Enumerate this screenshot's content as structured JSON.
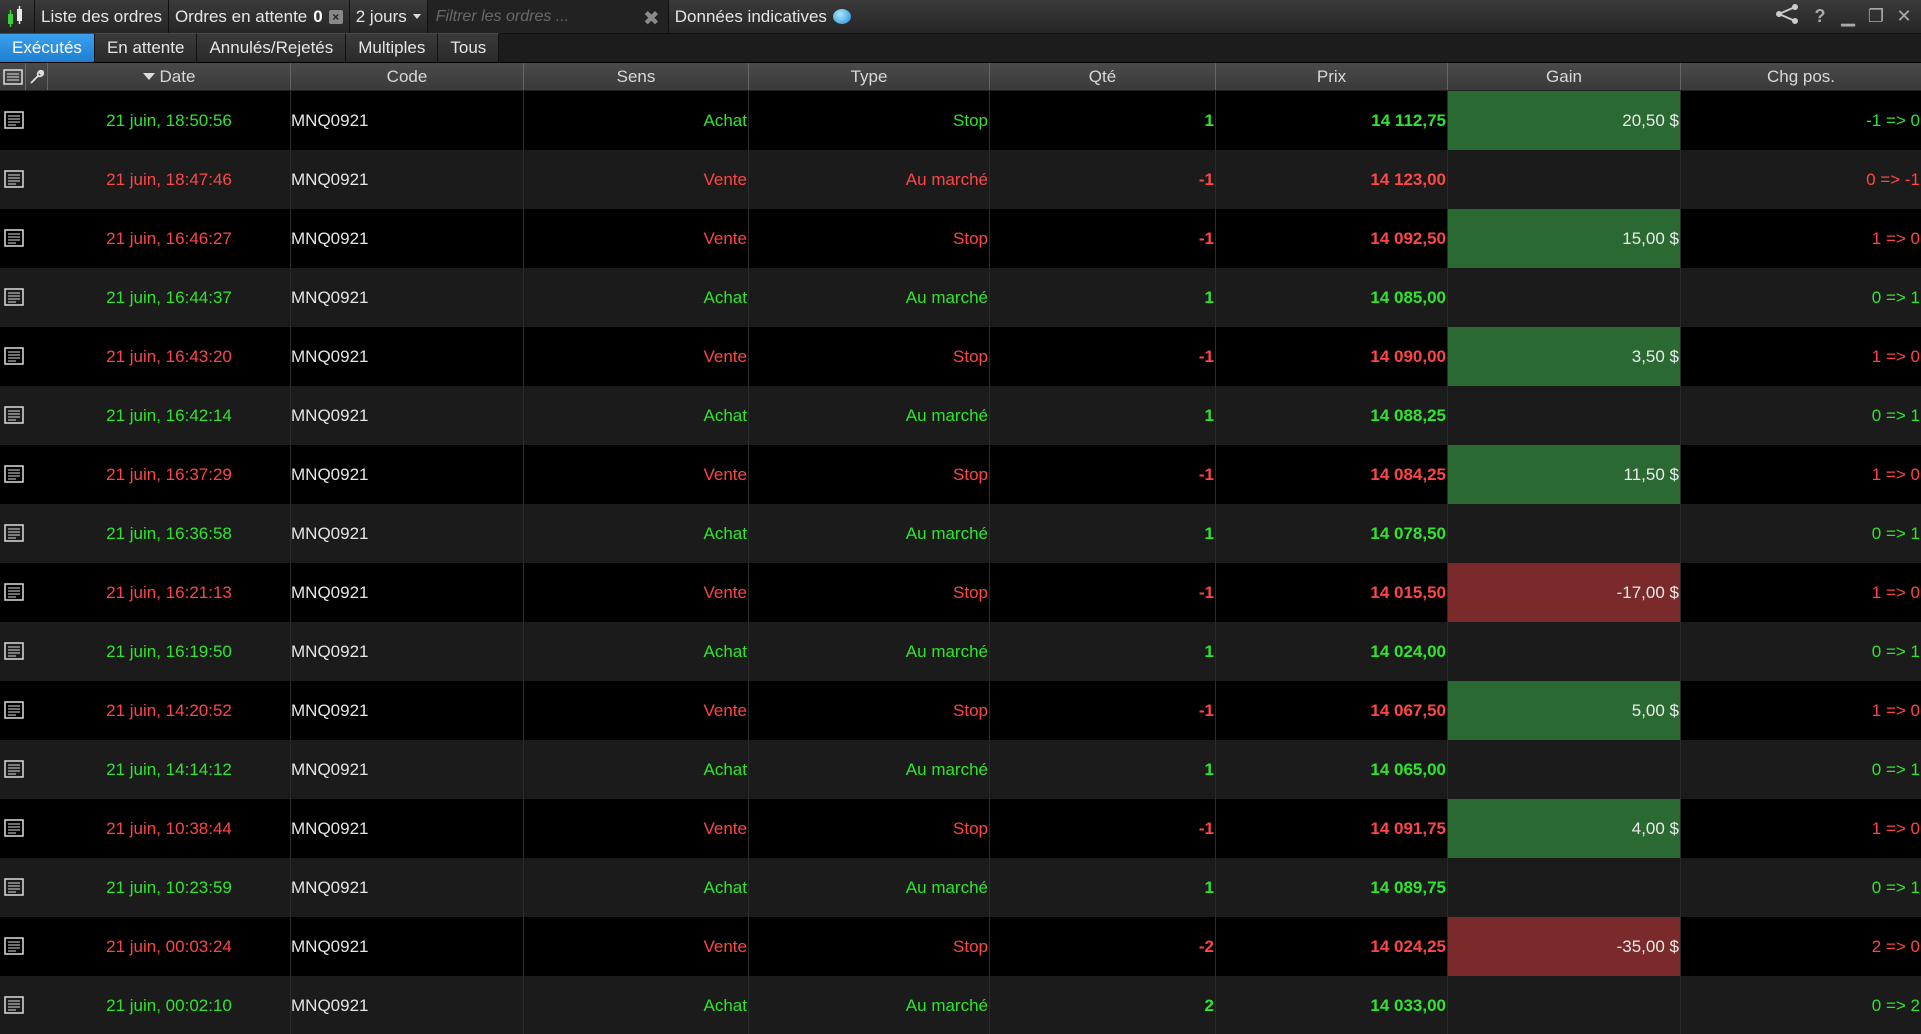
{
  "toolbar": {
    "orders_list_label": "Liste des ordres",
    "pending_label": "Ordres en attente",
    "pending_count": "0",
    "period_label": "2 jours",
    "filter_placeholder": "Filtrer les ordres ...",
    "filter_clear": "✖",
    "indicative_label": "Données indicatives",
    "help": "?"
  },
  "tabs": [
    {
      "label": "Exécutés",
      "active": true
    },
    {
      "label": "En attente",
      "active": false
    },
    {
      "label": "Annulés/Rejetés",
      "active": false
    },
    {
      "label": "Multiples",
      "active": false
    },
    {
      "label": "Tous",
      "active": false
    }
  ],
  "columns": {
    "date": "Date",
    "code": "Code",
    "sens": "Sens",
    "type": "Type",
    "qty": "Qté",
    "price": "Prix",
    "gain": "Gain",
    "pos": "Chg pos."
  },
  "colors": {
    "buy": "#2ee52e",
    "sell": "#ff4545",
    "gain_positive_bg": "#2a6a32",
    "gain_negative_bg": "#7a2a2a",
    "active_tab": "#2d8fe0"
  },
  "rows": [
    {
      "date": "21 juin, 18:50:56",
      "code": "MNQ0921",
      "sens": "Achat",
      "type": "Stop",
      "qty": "1",
      "price": "14 112,75",
      "gain": "20,50 $",
      "gain_sign": "pos",
      "pos": "-1 => 0"
    },
    {
      "date": "21 juin, 18:47:46",
      "code": "MNQ0921",
      "sens": "Vente",
      "type": "Au marché",
      "qty": "-1",
      "price": "14 123,00",
      "gain": "",
      "gain_sign": "",
      "pos": "0 => -1"
    },
    {
      "date": "21 juin, 16:46:27",
      "code": "MNQ0921",
      "sens": "Vente",
      "type": "Stop",
      "qty": "-1",
      "price": "14 092,50",
      "gain": "15,00 $",
      "gain_sign": "pos",
      "pos": "1 => 0"
    },
    {
      "date": "21 juin, 16:44:37",
      "code": "MNQ0921",
      "sens": "Achat",
      "type": "Au marché",
      "qty": "1",
      "price": "14 085,00",
      "gain": "",
      "gain_sign": "",
      "pos": "0 => 1"
    },
    {
      "date": "21 juin, 16:43:20",
      "code": "MNQ0921",
      "sens": "Vente",
      "type": "Stop",
      "qty": "-1",
      "price": "14 090,00",
      "gain": "3,50 $",
      "gain_sign": "pos",
      "pos": "1 => 0"
    },
    {
      "date": "21 juin, 16:42:14",
      "code": "MNQ0921",
      "sens": "Achat",
      "type": "Au marché",
      "qty": "1",
      "price": "14 088,25",
      "gain": "",
      "gain_sign": "",
      "pos": "0 => 1"
    },
    {
      "date": "21 juin, 16:37:29",
      "code": "MNQ0921",
      "sens": "Vente",
      "type": "Stop",
      "qty": "-1",
      "price": "14 084,25",
      "gain": "11,50 $",
      "gain_sign": "pos",
      "pos": "1 => 0"
    },
    {
      "date": "21 juin, 16:36:58",
      "code": "MNQ0921",
      "sens": "Achat",
      "type": "Au marché",
      "qty": "1",
      "price": "14 078,50",
      "gain": "",
      "gain_sign": "",
      "pos": "0 => 1"
    },
    {
      "date": "21 juin, 16:21:13",
      "code": "MNQ0921",
      "sens": "Vente",
      "type": "Stop",
      "qty": "-1",
      "price": "14 015,50",
      "gain": "-17,00 $",
      "gain_sign": "neg",
      "pos": "1 => 0"
    },
    {
      "date": "21 juin, 16:19:50",
      "code": "MNQ0921",
      "sens": "Achat",
      "type": "Au marché",
      "qty": "1",
      "price": "14 024,00",
      "gain": "",
      "gain_sign": "",
      "pos": "0 => 1"
    },
    {
      "date": "21 juin, 14:20:52",
      "code": "MNQ0921",
      "sens": "Vente",
      "type": "Stop",
      "qty": "-1",
      "price": "14 067,50",
      "gain": "5,00 $",
      "gain_sign": "pos",
      "pos": "1 => 0"
    },
    {
      "date": "21 juin, 14:14:12",
      "code": "MNQ0921",
      "sens": "Achat",
      "type": "Au marché",
      "qty": "1",
      "price": "14 065,00",
      "gain": "",
      "gain_sign": "",
      "pos": "0 => 1"
    },
    {
      "date": "21 juin, 10:38:44",
      "code": "MNQ0921",
      "sens": "Vente",
      "type": "Stop",
      "qty": "-1",
      "price": "14 091,75",
      "gain": "4,00 $",
      "gain_sign": "pos",
      "pos": "1 => 0"
    },
    {
      "date": "21 juin, 10:23:59",
      "code": "MNQ0921",
      "sens": "Achat",
      "type": "Au marché",
      "qty": "1",
      "price": "14 089,75",
      "gain": "",
      "gain_sign": "",
      "pos": "0 => 1"
    },
    {
      "date": "21 juin, 00:03:24",
      "code": "MNQ0921",
      "sens": "Vente",
      "type": "Stop",
      "qty": "-2",
      "price": "14 024,25",
      "gain": "-35,00 $",
      "gain_sign": "neg",
      "pos": "2 => 0"
    },
    {
      "date": "21 juin, 00:02:10",
      "code": "MNQ0921",
      "sens": "Achat",
      "type": "Au marché",
      "qty": "2",
      "price": "14 033,00",
      "gain": "",
      "gain_sign": "",
      "pos": "0 => 2"
    }
  ]
}
